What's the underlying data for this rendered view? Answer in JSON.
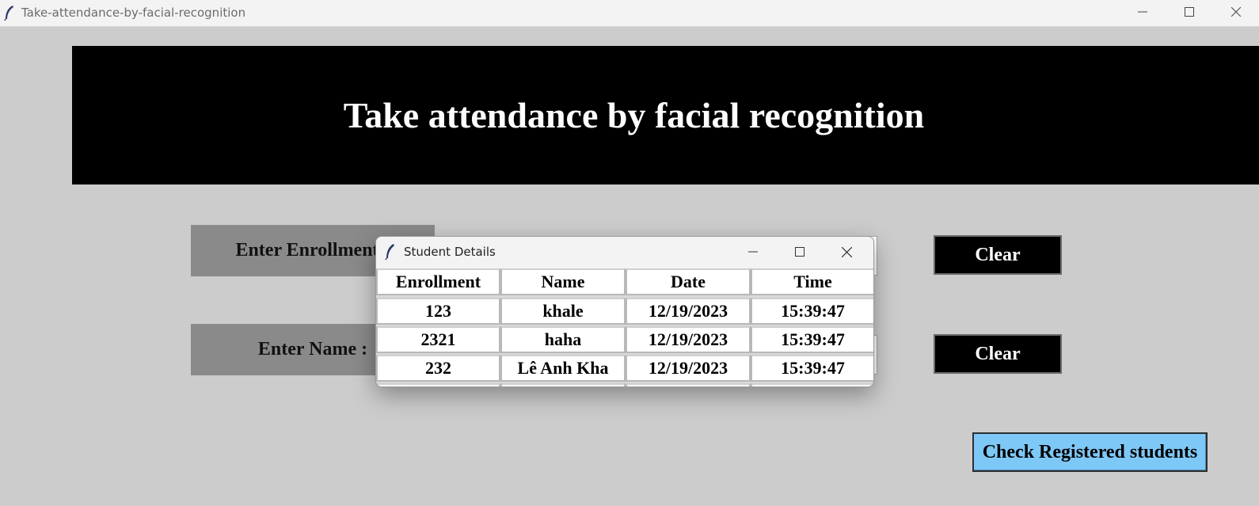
{
  "window": {
    "title": "Take-attendance-by-facial-recognition",
    "icon": "feather-icon",
    "controls": [
      "minimize-icon",
      "maximize-icon",
      "close-icon"
    ]
  },
  "banner": {
    "heading": "Take attendance by facial recognition"
  },
  "form": {
    "enrollment_label": "Enter Enrollment :",
    "enrollment_value": "",
    "name_label": "Enter Name :",
    "name_value": "",
    "clear_label_1": "Clear",
    "clear_label_2": "Clear",
    "check_registered_label": "Check Registered students"
  },
  "dialog": {
    "title": "Student Details",
    "icon": "feather-icon",
    "columns": [
      "Enrollment",
      "Name",
      "Date",
      "Time"
    ],
    "rows": [
      [
        "123",
        "khale",
        "12/19/2023",
        "15:39:47"
      ],
      [
        "2321",
        "haha",
        "12/19/2023",
        "15:39:47"
      ],
      [
        "232",
        "Lê Anh Kha",
        "12/19/2023",
        "15:39:47"
      ]
    ]
  },
  "colors": {
    "background": "#cccccc",
    "banner": "#000000",
    "label_bg": "#8a8a8a",
    "clear_bg": "#000000",
    "check_bg": "#7ec8f7"
  }
}
